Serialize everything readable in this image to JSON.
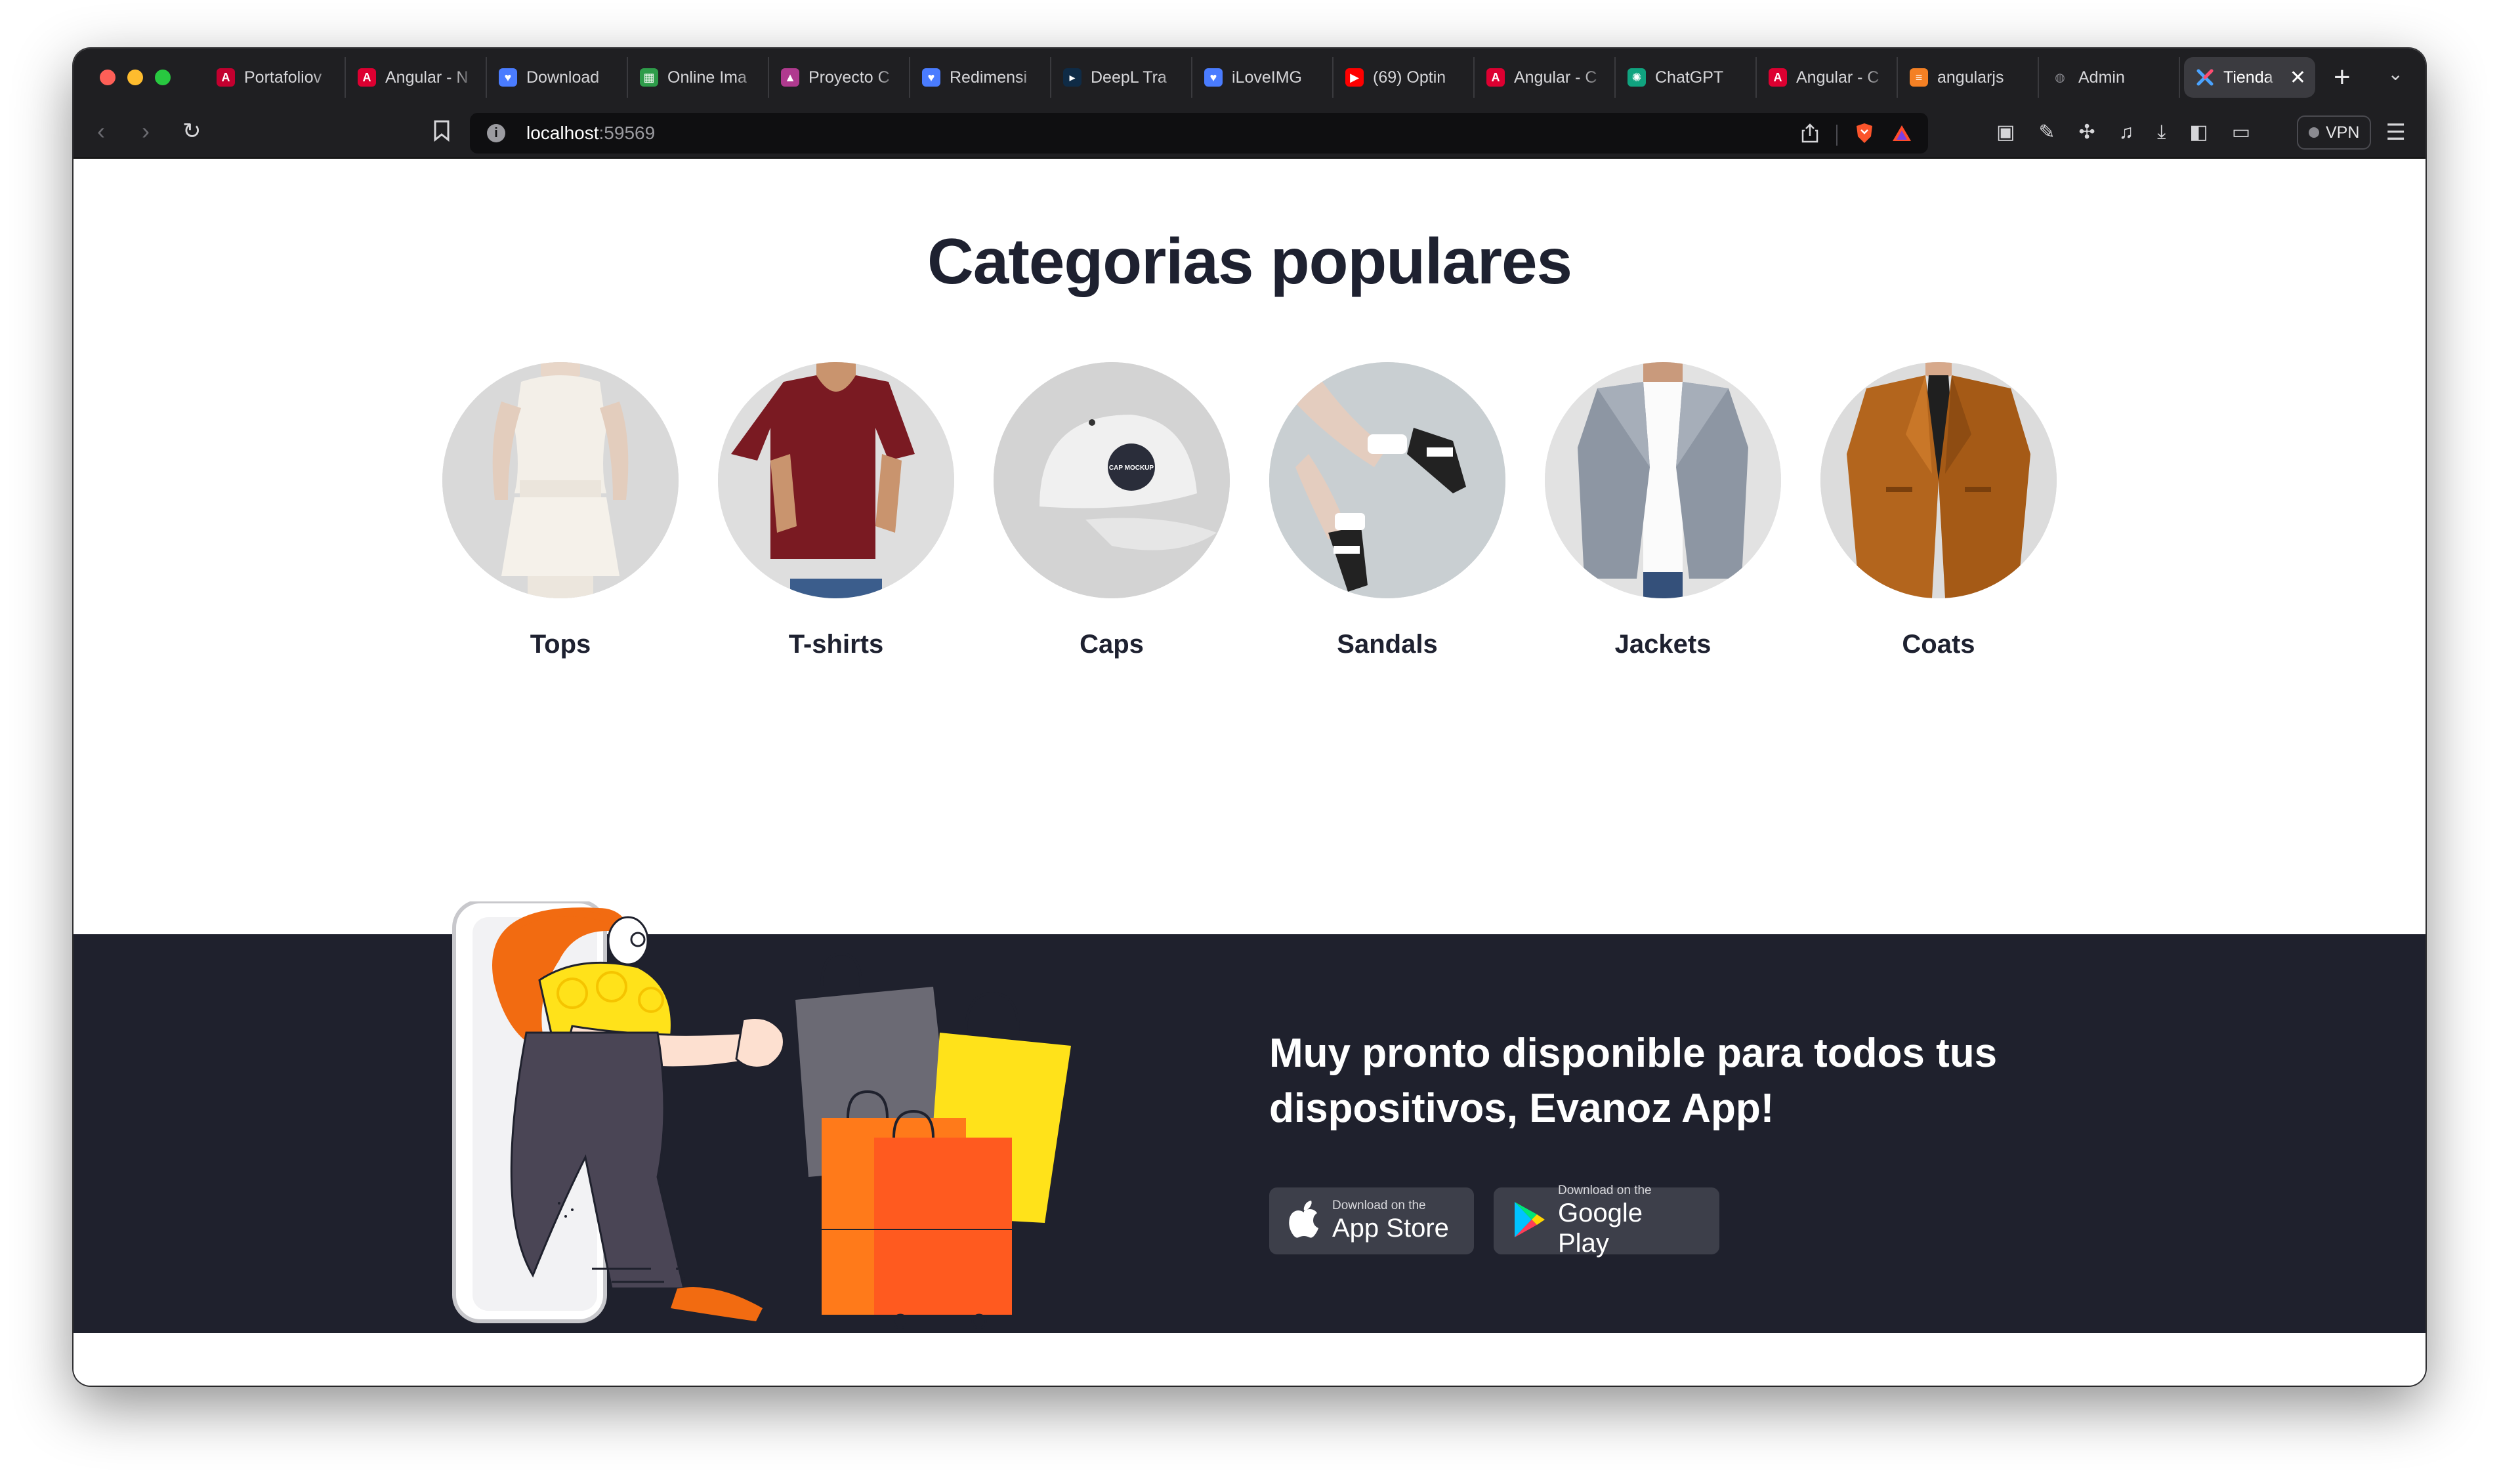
{
  "browser": {
    "tabs": [
      {
        "label": "Portafoliov",
        "icon": "angular-purple-icon",
        "color": "#c3002f"
      },
      {
        "label": "Angular - N",
        "icon": "angular-icon",
        "color": "#dd0031"
      },
      {
        "label": "Download",
        "icon": "heart-icon",
        "color": "#4a7cff"
      },
      {
        "label": "Online Ima",
        "icon": "grid-icon",
        "color": "#2e9c4a"
      },
      {
        "label": "Proyecto C",
        "icon": "triangle-icon",
        "color": "#b03a8f"
      },
      {
        "label": "Redimensi",
        "icon": "heart-icon",
        "color": "#4a7cff"
      },
      {
        "label": "DeepL Tra",
        "icon": "deepl-icon",
        "color": "#0f2b46"
      },
      {
        "label": "iLoveIMG",
        "icon": "heart-icon",
        "color": "#4a7cff"
      },
      {
        "label": "(69) Optin",
        "icon": "youtube-icon",
        "color": "#ff0000"
      },
      {
        "label": "Angular - C",
        "icon": "angular-icon",
        "color": "#dd0031"
      },
      {
        "label": "ChatGPT",
        "icon": "chatgpt-icon",
        "color": "#10a37f"
      },
      {
        "label": "Angular - C",
        "icon": "angular-icon",
        "color": "#dd0031"
      },
      {
        "label": "angularjs",
        "icon": "stackoverflow-icon",
        "color": "#f48024"
      },
      {
        "label": "Admin",
        "icon": "globe-icon",
        "color": "#8a8a90"
      }
    ],
    "active_tab": {
      "label": "Tienda",
      "icon": "x-logo-icon"
    },
    "url_host": "localhost",
    "url_port": ":59569",
    "vpn_label": "VPN"
  },
  "page": {
    "categories_title": "Categorias populares",
    "categories": [
      {
        "label": "Tops",
        "image": "tops-image"
      },
      {
        "label": "T-shirts",
        "image": "tshirts-image"
      },
      {
        "label": "Caps",
        "image": "caps-image"
      },
      {
        "label": "Sandals",
        "image": "sandals-image"
      },
      {
        "label": "Jackets",
        "image": "jackets-image"
      },
      {
        "label": "Coats",
        "image": "coats-image"
      }
    ],
    "cap_badge_text": "CAP MOCKUP",
    "banner": {
      "title": "Muy pronto disponible para todos tus dispositivos, Evanoz App!",
      "app_store": {
        "small": "Download on the",
        "big": "App Store"
      },
      "google_play": {
        "small": "Download on the",
        "big": "Google Play"
      }
    }
  },
  "colors": {
    "heading": "#1e2130",
    "banner_bg": "#1f212d",
    "store_button_bg": "#3d3f4a",
    "browser_chrome": "#1f1f22"
  }
}
